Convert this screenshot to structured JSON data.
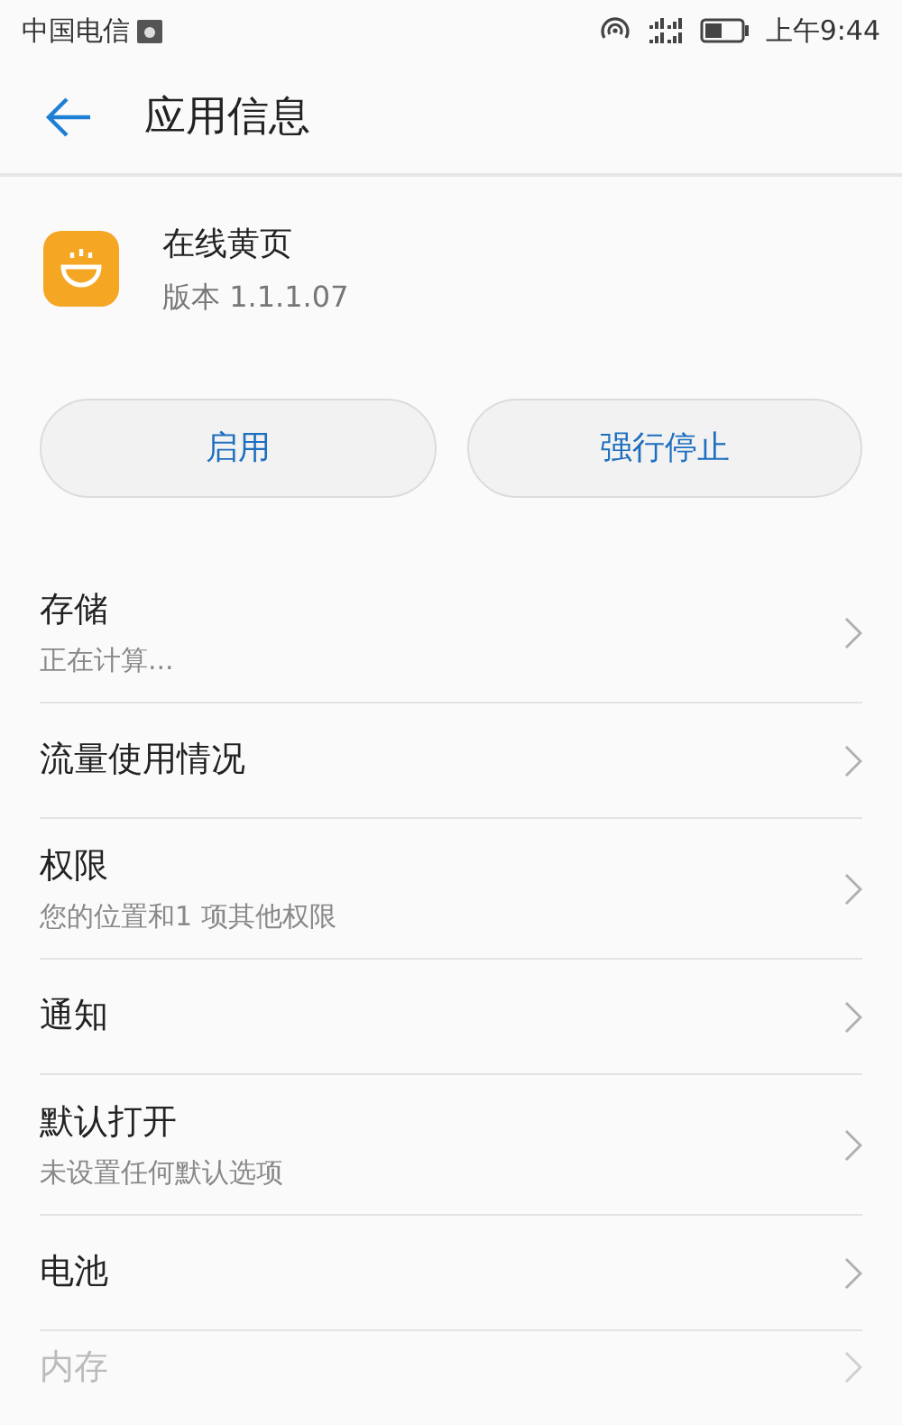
{
  "status_bar": {
    "carrier": "中国电信",
    "time": "上午9:44"
  },
  "header": {
    "title": "应用信息"
  },
  "app": {
    "name": "在线黄页",
    "version": "版本 1.1.1.07"
  },
  "buttons": [
    "启用",
    "强行停止"
  ],
  "settings": [
    {
      "title": "存储",
      "subtitle": "正在计算...",
      "disabled": false
    },
    {
      "title": "流量使用情况",
      "disabled": false
    },
    {
      "title": "权限",
      "subtitle": "您的位置和1 项其他权限",
      "disabled": false
    },
    {
      "title": "通知",
      "disabled": false
    },
    {
      "title": "默认打开",
      "subtitle": "未设置任何默认选项",
      "disabled": false
    },
    {
      "title": "电池",
      "disabled": false
    },
    {
      "title": "内存",
      "disabled": true
    }
  ]
}
